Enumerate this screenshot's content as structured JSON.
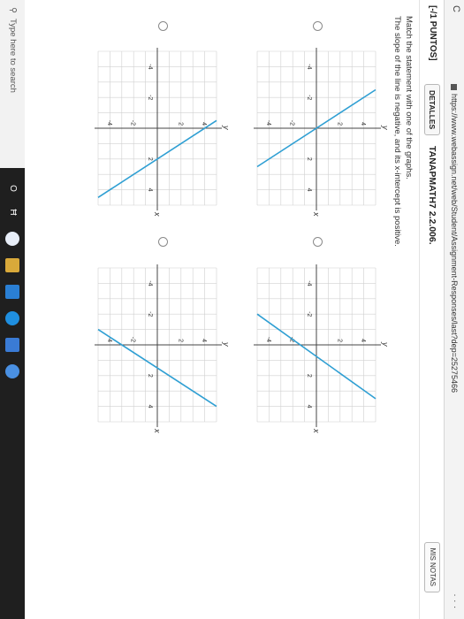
{
  "browser": {
    "url": "https://www.webassign.net/web/Student/Assignment-Responses/last?dep=25275466",
    "menu_dots": "...",
    "nav": "C"
  },
  "question": {
    "points": "[-/1 PUNTOS]",
    "details_button": "DETALLES",
    "code": "TANAPMATH7 2.2.006.",
    "notes_button": "MIS NOTAS",
    "instruction": "Match the statement with one of the graphs.",
    "statement": "The slope of the line is negative, and its x-intercept is positive."
  },
  "graph_labels": {
    "x_axis": "x",
    "y_axis": "y",
    "ticks": [
      "-4",
      "-2",
      "2",
      "4"
    ]
  },
  "taskbar": {
    "search_placeholder": "Type here to search",
    "cortana": "O",
    "taskview": "Ħ"
  },
  "colors": {
    "line": "#2f9fd3",
    "axis": "#444444",
    "grid": "#d0d0d0",
    "taskbar": "#1f1f1f"
  },
  "chart_data": [
    {
      "type": "line",
      "name": "graph-1",
      "xlim": [
        -5,
        5
      ],
      "ylim": [
        -5,
        5
      ],
      "series": [
        {
          "x": [
            -2.5,
            2.5
          ],
          "y": [
            5,
            -5
          ]
        }
      ]
    },
    {
      "type": "line",
      "name": "graph-2",
      "xlim": [
        -5,
        5
      ],
      "ylim": [
        -5,
        5
      ],
      "series": [
        {
          "x": [
            -2,
            3.5
          ],
          "y": [
            -5,
            5
          ]
        }
      ]
    },
    {
      "type": "line",
      "name": "graph-3",
      "xlim": [
        -5,
        5
      ],
      "ylim": [
        -5,
        5
      ],
      "series": [
        {
          "x": [
            -0.5,
            4.5
          ],
          "y": [
            5,
            -5
          ]
        }
      ]
    },
    {
      "type": "line",
      "name": "graph-4",
      "xlim": [
        -5,
        5
      ],
      "ylim": [
        -5,
        5
      ],
      "series": [
        {
          "x": [
            -1,
            4
          ],
          "y": [
            -5,
            5
          ]
        }
      ]
    }
  ]
}
